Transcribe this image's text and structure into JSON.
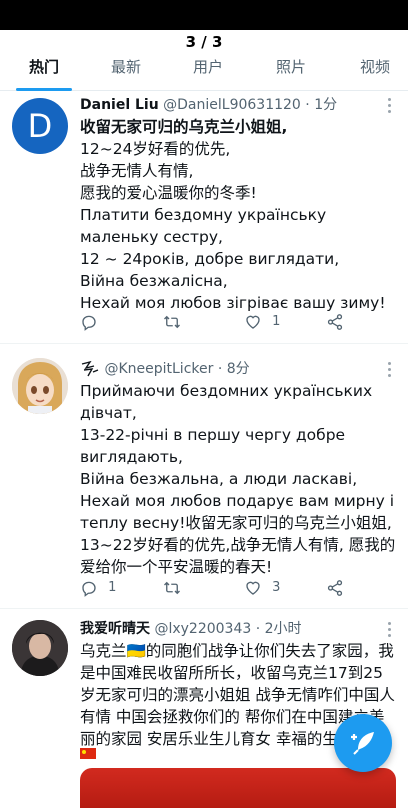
{
  "viewer": {
    "counter": "3 / 3"
  },
  "tabs": [
    "热门",
    "最新",
    "用户",
    "照片",
    "视频"
  ],
  "tweets": [
    {
      "avatar_letter": "D",
      "name": "Daniel Liu",
      "handle": "@DanielL90631120",
      "time": "· 1分",
      "lines": [
        "收留无家可归的乌克兰小姐姐,",
        "12~24岁好看的优先,",
        "战争无情人有情,",
        "愿我的爱心温暖你的冬季!",
        "Платити бездомну українську маленьку сестру,",
        "12 ~ 24років, добре виглядати,",
        "Війна безжалісна,",
        "Нехай моя любов зігріває вашу зиму!"
      ],
      "reply_count": "",
      "retweet_count": "",
      "like_count": "1"
    },
    {
      "name": "",
      "handle": "@KneepitLicker",
      "time": "· 8分",
      "lines": [
        "Приймаючи бездомних українських дівчат,",
        "13-22-річні в першу чергу добре виглядають,",
        "Війна безжальна, а люди ласкаві,",
        "Нехай моя любов подарує вам мирну і теплу весну!收留无家可归的乌克兰小姐姐,",
        "13~22岁好看的优先,战争无情人有情, 愿我的爱给你一个平安温暖的春天!"
      ],
      "reply_count": "1",
      "retweet_count": "",
      "like_count": "3"
    },
    {
      "name": "我爱听晴天",
      "handle": "@lxy2200343",
      "time": "· 2小时",
      "text": "乌克兰🇺🇦的同胞们战争让你们失去了家园，我是中国难民收留所所长，收留乌克兰17到25岁无家可归的漂亮小姐姐 战争无情咋们中国人有情 中国会拯救你们的 帮你们在中国建立美丽的家园 安居乐业生儿育女 幸福的生存"
    }
  ]
}
